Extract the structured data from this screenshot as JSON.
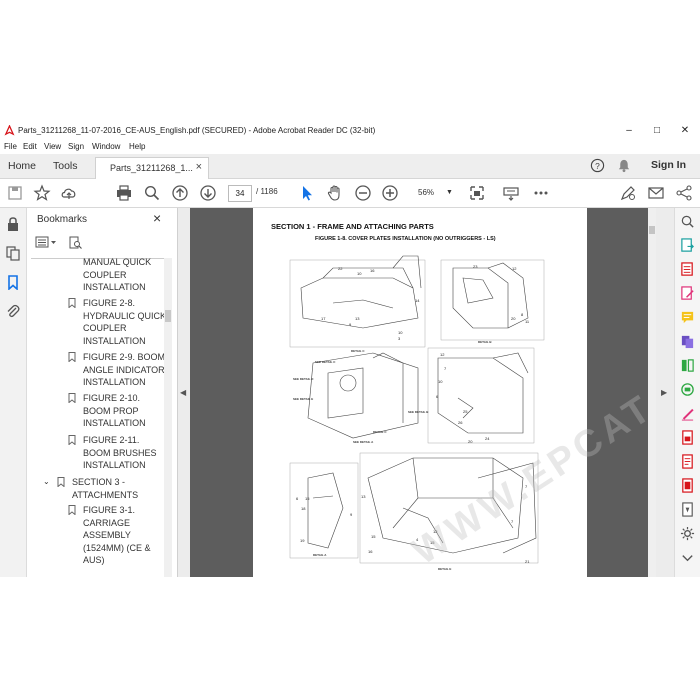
{
  "window": {
    "title": "Parts_31211268_11-07-2016_CE-AUS_English.pdf (SECURED) - Adobe Acrobat Reader DC (32-bit)"
  },
  "menu": [
    "File",
    "Edit",
    "View",
    "Sign",
    "Window",
    "Help"
  ],
  "tabs": {
    "home": "Home",
    "tools": "Tools",
    "document": "Parts_31211268_1...",
    "sign_in": "Sign In"
  },
  "toolbar": {
    "page_current": "34",
    "page_total": "/ 1186",
    "zoom": "56%"
  },
  "bookmarks": {
    "title": "Bookmarks",
    "items": [
      {
        "text": "MANUAL QUICK\nCOUPLER\nINSTALLATION",
        "level": 2
      },
      {
        "text": "FIGURE 2-8.\nHYDRAULIC QUICK\nCOUPLER\nINSTALLATION",
        "level": 2
      },
      {
        "text": "FIGURE 2-9. BOOM\nANGLE INDICATOR\nINSTALLATION",
        "level": 2
      },
      {
        "text": "FIGURE 2-10.\nBOOM PROP\nINSTALLATION",
        "level": 2
      },
      {
        "text": "FIGURE 2-11.\nBOOM BRUSHES\nINSTALLATION",
        "level": 2
      },
      {
        "text": "SECTION 3 -\nATTACHMENTS",
        "level": 1
      },
      {
        "text": "FIGURE 3-1.\nCARRIAGE\nASSEMBLY\n(1524MM) (CE &\nAUS)",
        "level": 2
      }
    ]
  },
  "document_page": {
    "section_title": "SECTION 1 - FRAME AND ATTACHING PARTS",
    "figure_title": "FIGURE 1-8. COVER PLATES INSTALLATION (NO OUTRIGGERS - LS)",
    "detail_labels": [
      "DETAIL C",
      "DETAIL B",
      "DETAIL D",
      "DETAIL A",
      "DETAIL E"
    ],
    "see_labels": [
      "SEE DETAIL C",
      "SEE DETAIL D",
      "SEE DETAIL E",
      "SEE DETAIL B",
      "SEE DETAIL A"
    ],
    "part_numbers": [
      "22",
      "10",
      "14",
      "17",
      "13",
      "9",
      "10",
      "3",
      "23",
      "20",
      "11",
      "8",
      "6",
      "18",
      "19",
      "9",
      "25",
      "26",
      "24",
      "7",
      "16",
      "15",
      "12",
      "4",
      "21"
    ],
    "watermark": "WWW.EPCATALOGS.COM"
  },
  "colors": {
    "accent_red": "#d7141a",
    "doc_background": "#5d5d5d",
    "tab_background": "#eeeeee",
    "active_blue": "#1473e6"
  }
}
